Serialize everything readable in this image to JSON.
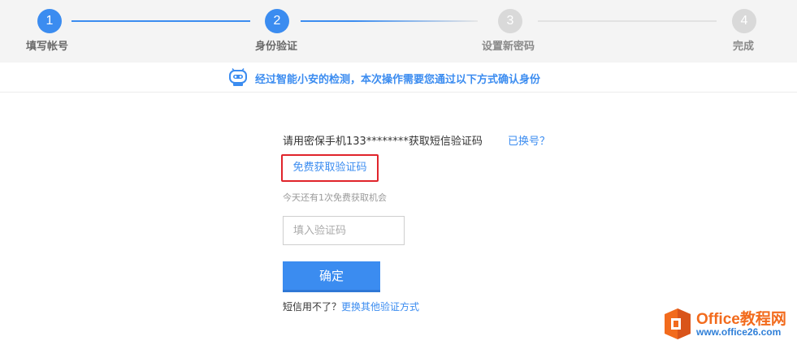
{
  "steps": [
    {
      "number": "1",
      "label": "填写帐号",
      "state": "done"
    },
    {
      "number": "2",
      "label": "身份验证",
      "state": "current"
    },
    {
      "number": "3",
      "label": "设置新密码",
      "state": "todo"
    },
    {
      "number": "4",
      "label": "完成",
      "state": "todo"
    }
  ],
  "notice": {
    "text": "经过智能小安的检测，本次操作需要您通过以下方式确认身份",
    "icon": "robot-icon"
  },
  "verify": {
    "phone_prompt": "请用密保手机133********获取短信验证码",
    "change_number": "已换号？",
    "get_code": "免费获取验证码",
    "chances": "今天还有1次免费获取机会",
    "code_placeholder": "填入验证码",
    "code_value": "",
    "confirm": "确定",
    "fallback_question": "短信用不了？",
    "fallback_link": "更换其他验证方式"
  },
  "watermark": {
    "brand": "Office教程网",
    "url": "www.office26.com"
  },
  "colors": {
    "accent": "#3b8cf0",
    "highlight_border": "#e0242b",
    "inactive_step": "#d9d9d9"
  }
}
